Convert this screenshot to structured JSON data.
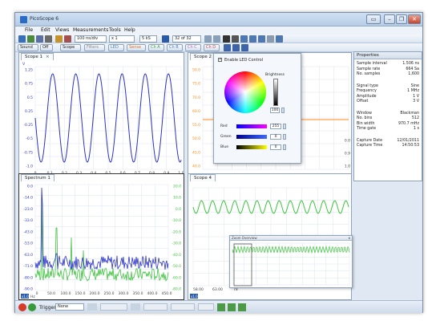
{
  "app": {
    "title": "PicoScope 6",
    "window_buttons": {
      "minimize": "–",
      "restore": "❐",
      "close": "✕",
      "extra": "▭"
    }
  },
  "menu": [
    "File",
    "Edit",
    "Views",
    "Measurements",
    "Tools",
    "Help"
  ],
  "toolbar": {
    "timebase": "100 ns/div",
    "zoom": "x 1",
    "samples": "5 kS",
    "capture_count": "32 of 32",
    "sound_label": "Sound",
    "off_label": "Off",
    "scope_label": "Scope",
    "filters_label": "Filters",
    "ch_buttons": [
      "LED",
      "Sense",
      "Ch A",
      "Ch B",
      "Ch C",
      "Ch D"
    ]
  },
  "scope1": {
    "tab": "Scope 1",
    "channel": "V",
    "y_ticks": [
      "1.25",
      "0.75",
      "0.5",
      "0.25",
      "-0.25",
      "-0.5",
      "-0.75",
      "-1.0"
    ],
    "x_ticks": [
      "0",
      "0.1",
      "0.2",
      "0.3",
      "0.4",
      "0.5",
      "0.6",
      "0.7",
      "0.8",
      "0.9",
      "1.0"
    ],
    "unit": "µs",
    "zoom_label": "x1.0"
  },
  "scope2": {
    "tab": "Scope 2",
    "y_ticks": [
      "50.0",
      "75.0",
      "70.0",
      "60.0",
      "55.0",
      "50.0",
      "45.0",
      "40.0"
    ],
    "x_ticks": [
      "0",
      "0.1",
      "0.2"
    ],
    "right_ticks": [
      "0.0",
      "0.9",
      "1.0"
    ]
  },
  "led_dialog": {
    "enable_label": "Enable LED Control",
    "brightness_label": "Brightness",
    "brightness_value": "100",
    "red_label": "Red",
    "red_value": "255",
    "green_label": "Green",
    "green_value": "0",
    "blue_label": "Blue",
    "blue_value": "0"
  },
  "spectrum1": {
    "tab": "Spectrum 1",
    "left_ticks": [
      "0.0",
      "-14.0",
      "-23.0",
      "-33.0",
      "-43.0",
      "-53.0",
      "-63.0",
      "-71.0",
      "-80.0",
      "-90.0"
    ],
    "right_ticks": [
      "20.0",
      "10.0",
      "0.0",
      "-10.0",
      "-20.0",
      "-30.0",
      "-40.0",
      "-50.0",
      "-60.0",
      "-80.0"
    ],
    "x_ticks": [
      "0",
      "50.0",
      "100.0",
      "150.0",
      "200.0",
      "250.0",
      "300.0",
      "350.0",
      "400.0",
      "450.0"
    ],
    "unit": "Hz",
    "zoom_label": "x1.0"
  },
  "scope4": {
    "tab": "Scope 4",
    "x_ticks": [
      "58.00",
      "63.00",
      "78"
    ],
    "zoom_label": "x1.0"
  },
  "zoom_overview": {
    "title": "Zoom Overview",
    "close": "x"
  },
  "properties": {
    "title": "Properties",
    "groups": [
      [
        [
          "Sample interval",
          "1.506 ns"
        ],
        [
          "Sample rate",
          "664 Sa"
        ],
        [
          "No. samples",
          "1,600"
        ]
      ],
      [
        [
          "Signal type",
          "Sine"
        ],
        [
          "Frequency",
          "1 MHz"
        ],
        [
          "Amplitude",
          "1 V"
        ],
        [
          "Offset",
          "3 V"
        ]
      ],
      [
        [
          "Window",
          "Blackman"
        ],
        [
          "No. bins",
          "512"
        ],
        [
          "Bin width",
          "970.7 mHz"
        ],
        [
          "Time gate",
          "1 s"
        ]
      ],
      [
        [
          "Capture Date",
          "12/01/2011"
        ],
        [
          "Capture Time",
          "14:50:53"
        ]
      ]
    ]
  },
  "status": {
    "trigger_label": "Trigger",
    "trigger_value": "None"
  },
  "colors": {
    "blue_trace": "#2b33c8",
    "green_trace": "#3ec43e",
    "orange_trace": "#ff8a1a",
    "grid": "#d9e4ef"
  }
}
